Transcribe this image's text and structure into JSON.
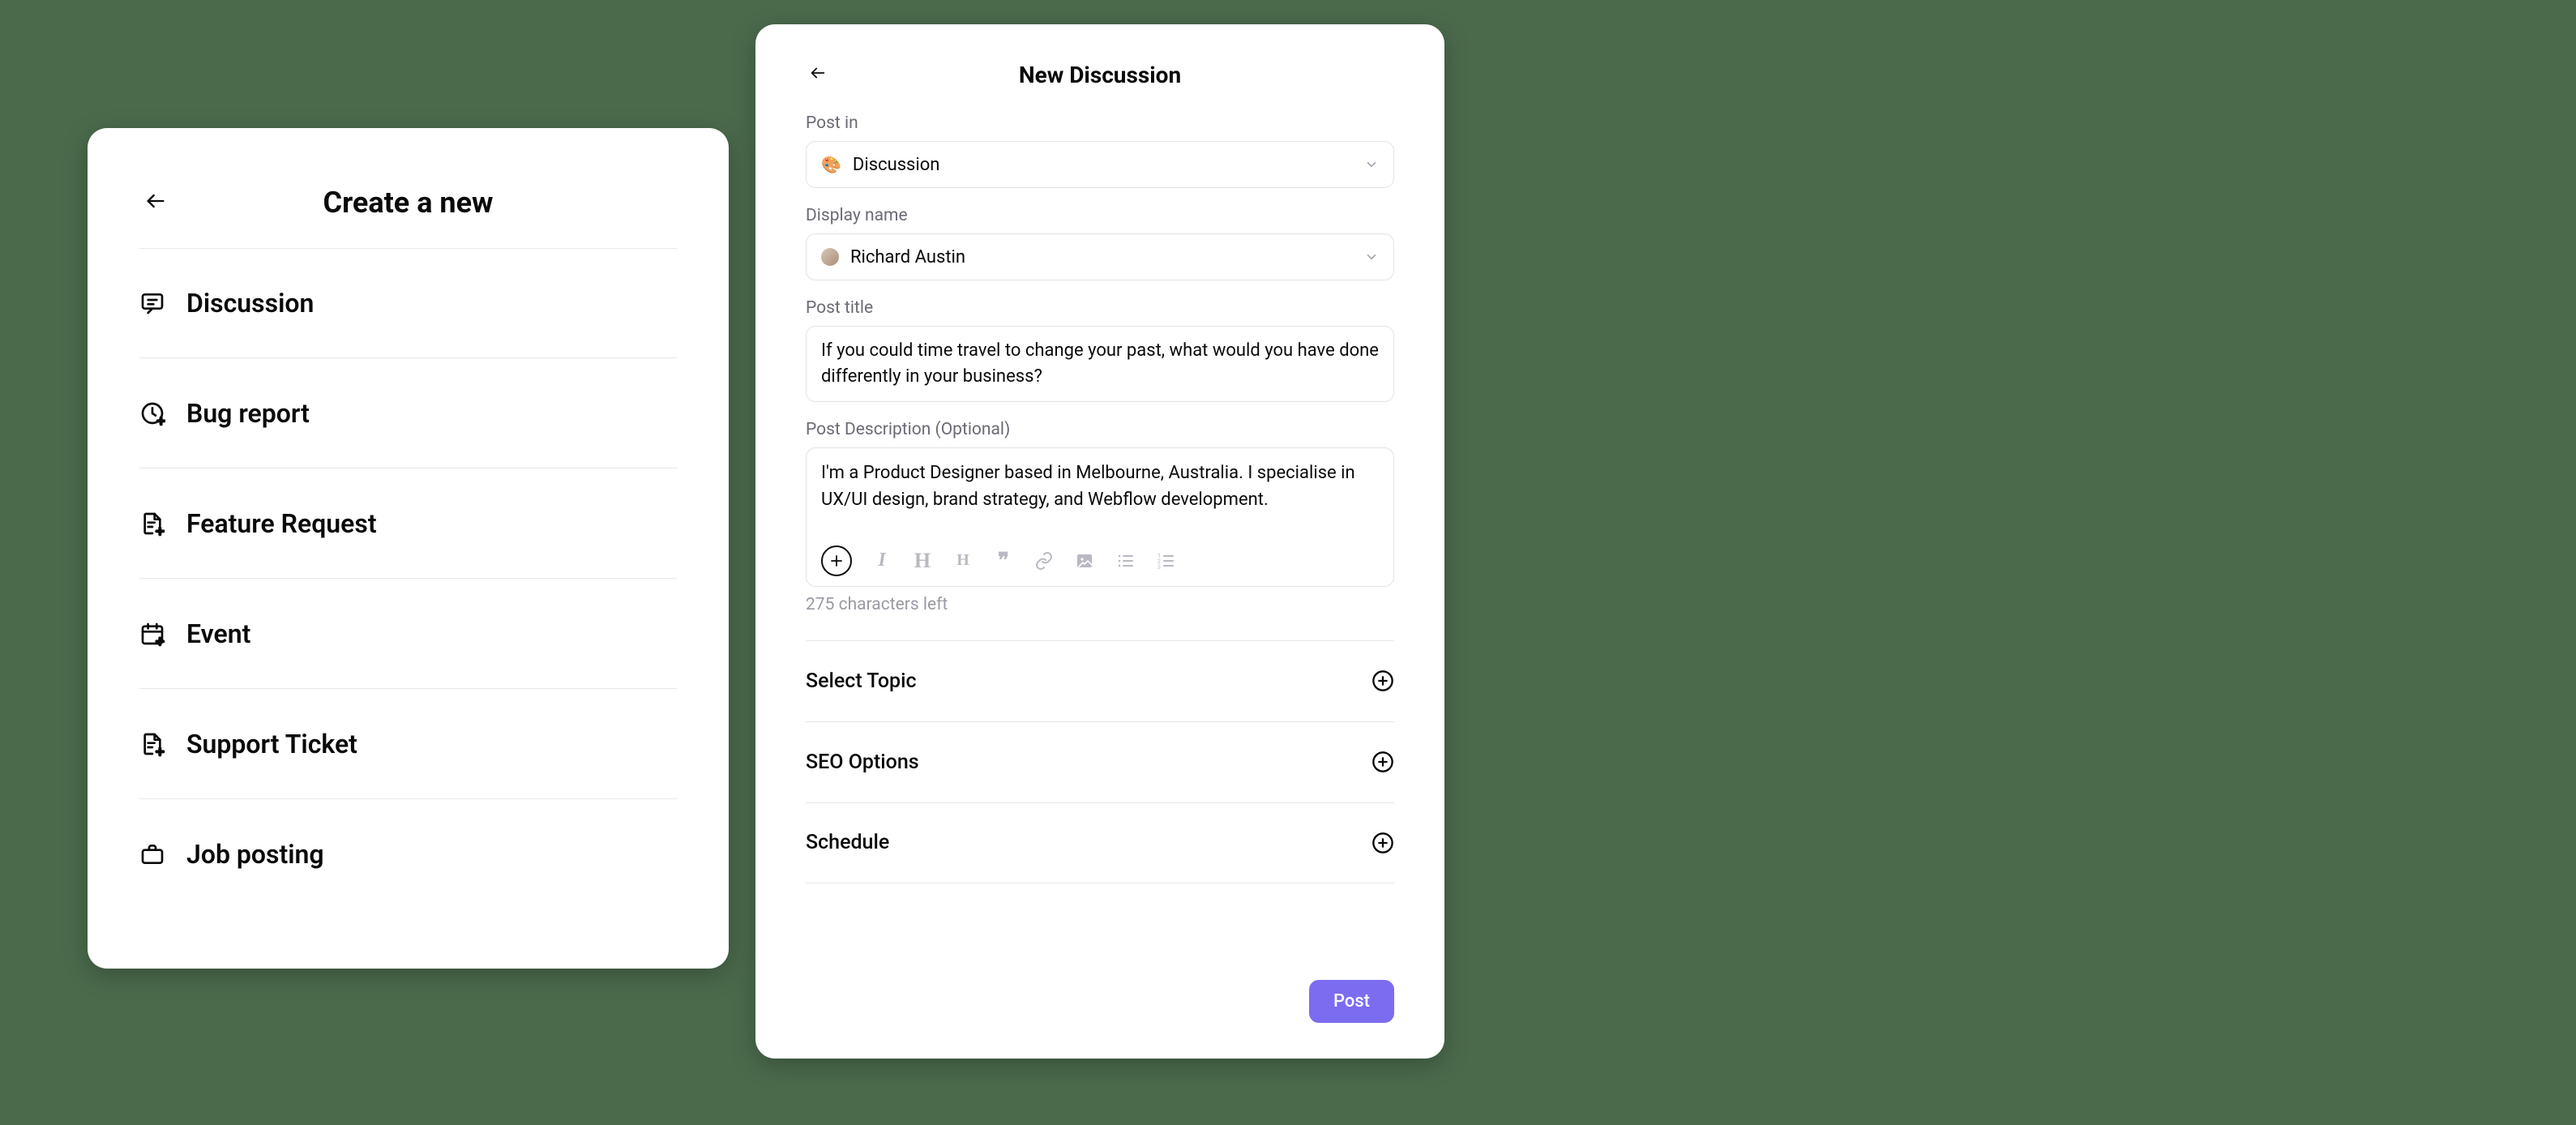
{
  "left": {
    "title": "Create a new",
    "items": [
      {
        "label": "Discussion"
      },
      {
        "label": "Bug report"
      },
      {
        "label": "Feature Request"
      },
      {
        "label": "Event"
      },
      {
        "label": "Support Ticket"
      },
      {
        "label": "Job posting"
      }
    ]
  },
  "right": {
    "title": "New Discussion",
    "post_in": {
      "label": "Post in",
      "value": "Discussion",
      "emoji": "🎨"
    },
    "display_name": {
      "label": "Display name",
      "value": "Richard Austin"
    },
    "post_title": {
      "label": "Post title",
      "value": "If you could time travel to change your past, what would you have done differently in your business?"
    },
    "post_desc": {
      "label": "Post Description (Optional)",
      "value": "I'm a Product Designer based in Melbourne, Australia. I specialise in UX/UI design, brand strategy, and Webflow development."
    },
    "counter": "275 characters left",
    "sections": [
      {
        "label": "Select Topic"
      },
      {
        "label": "SEO Options"
      },
      {
        "label": "Schedule"
      }
    ],
    "post_button": "Post"
  }
}
